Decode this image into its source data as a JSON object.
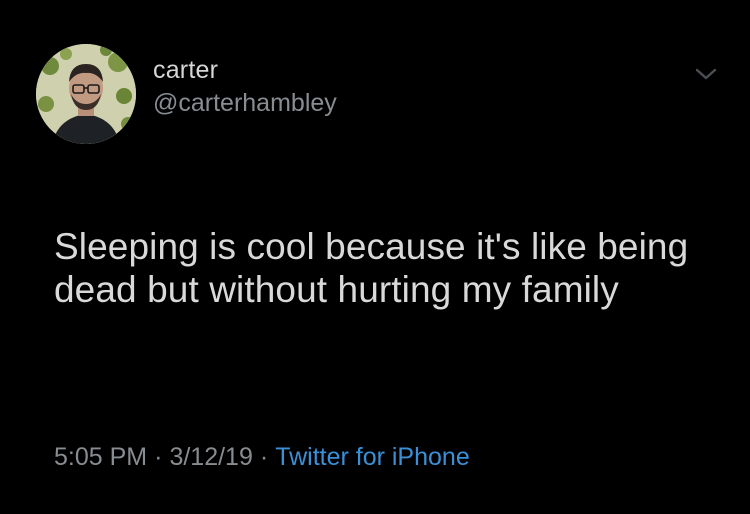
{
  "tweet": {
    "display_name": "carter",
    "handle": "@carterhambley",
    "text": "Sleeping is cool because it's like being dead but without hurting my family",
    "time": "5:05 PM",
    "separator": "·",
    "date": "3/12/19",
    "source": "Twitter for iPhone"
  },
  "icons": {
    "avatar": "profile-photo",
    "menu": "chevron-down-icon"
  },
  "colors": {
    "background": "#000000",
    "text": "#d9d9d9",
    "secondary": "#878c91",
    "link": "#3a8fd6"
  }
}
